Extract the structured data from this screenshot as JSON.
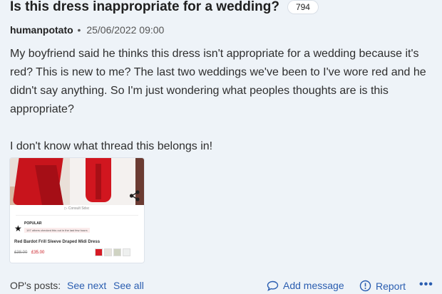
{
  "thread": {
    "title": "Is this dress inappropriate for a wedding?",
    "reply_count": "794"
  },
  "post": {
    "author": "humanpotato",
    "separator": "•",
    "timestamp": "25/06/2022 09:00",
    "paragraphs": [
      "My boyfriend said he thinks this dress isn't appropriate for a wedding because it's red? This is new to me? The last two weddings we've been to I've wore red and he didn't say anything. So I'm just wondering what peoples thoughts are is this appropriate?",
      "I don't know what thread this belongs in!"
    ]
  },
  "attachment": {
    "consult_text": "Consult Sdsc",
    "popular_label": "POPULAR",
    "popular_sub": "197 others checked this out in the last few hours",
    "product_name": "Red Bardot Frill Sleeve Draped Midi Dress",
    "price_old": "£38.00",
    "price_new": "£35.00",
    "swatch_colors": [
      "#d61b25",
      "#e7e3dd",
      "#cfd3c2",
      "#eef0ef"
    ]
  },
  "footer": {
    "ops_label": "OP's posts:",
    "see_next": "See next",
    "see_all": "See all",
    "add_message": "Add message",
    "report": "Report",
    "more": "•••"
  },
  "colors": {
    "background": "#eef3f8",
    "link": "#2a5db0",
    "dress_red": "#c8141c"
  }
}
